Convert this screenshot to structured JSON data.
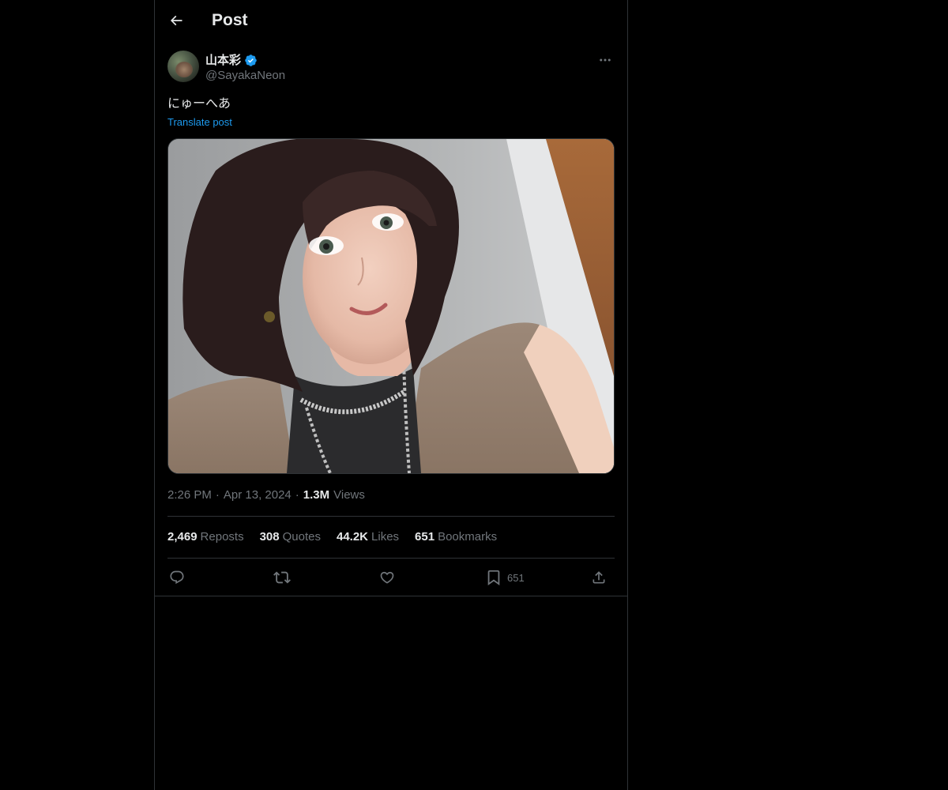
{
  "header": {
    "title": "Post",
    "back_icon": "arrow-left-icon"
  },
  "author": {
    "display_name": "山本彩",
    "handle": "@SayakaNeon",
    "verified": true,
    "verified_color": "#1d9bf0"
  },
  "post": {
    "text": "にゅーへあ",
    "translate_label": "Translate post",
    "time": "2:26 PM",
    "separator": "·",
    "date": "Apr 13, 2024",
    "views_count": "1.3M",
    "views_label": "Views"
  },
  "stats": {
    "reposts": {
      "count": "2,469",
      "label": "Reposts"
    },
    "quotes": {
      "count": "308",
      "label": "Quotes"
    },
    "likes": {
      "count": "44.2K",
      "label": "Likes"
    },
    "bookmarks": {
      "count": "651",
      "label": "Bookmarks"
    }
  },
  "actions": {
    "bookmark_count": "651",
    "icons": [
      "reply-icon",
      "repost-icon",
      "like-icon",
      "bookmark-icon",
      "share-icon"
    ]
  },
  "colors": {
    "background": "#000000",
    "text_primary": "#e7e9ea",
    "text_secondary": "#71767b",
    "accent": "#1d9bf0",
    "border": "#2f3336"
  }
}
